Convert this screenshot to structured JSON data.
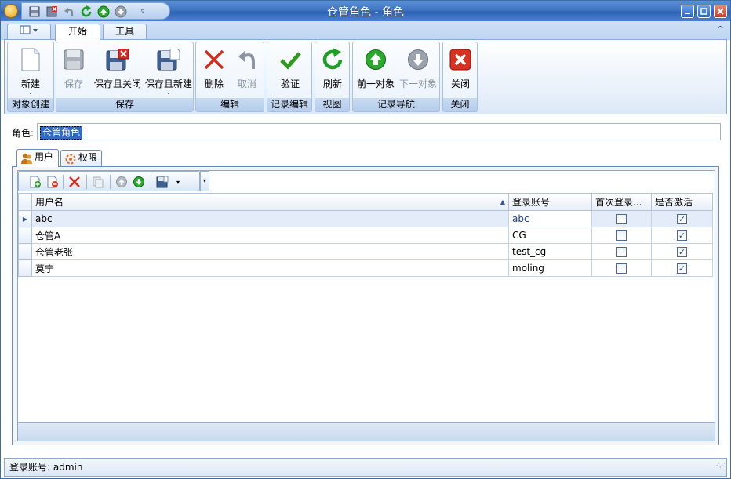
{
  "window": {
    "title": "仓管角色 - 角色"
  },
  "quick_access": [
    "save-icon",
    "save-close-icon",
    "undo-icon",
    "refresh-icon",
    "prev-icon",
    "next-icon",
    "customize-icon"
  ],
  "ribbon_tabs": [
    {
      "label": "开始",
      "active": true
    },
    {
      "label": "工具",
      "active": false
    }
  ],
  "ribbon": {
    "groups": [
      {
        "caption": "对象创建",
        "buttons": [
          {
            "label": "新建",
            "icon": "new-document-icon",
            "enabled": true,
            "dropdown": true
          }
        ]
      },
      {
        "caption": "保存",
        "buttons": [
          {
            "label": "保存",
            "icon": "save-icon",
            "enabled": false
          },
          {
            "label": "保存且关闭",
            "icon": "save-close-icon",
            "enabled": true
          },
          {
            "label": "保存且新建",
            "icon": "save-new-icon",
            "enabled": true,
            "dropdown": true
          }
        ]
      },
      {
        "caption": "编辑",
        "buttons": [
          {
            "label": "删除",
            "icon": "delete-icon",
            "enabled": true
          },
          {
            "label": "取消",
            "icon": "undo-icon",
            "enabled": false
          }
        ]
      },
      {
        "caption": "记录编辑",
        "buttons": [
          {
            "label": "验证",
            "icon": "check-icon",
            "enabled": true
          }
        ]
      },
      {
        "caption": "视图",
        "buttons": [
          {
            "label": "刷新",
            "icon": "refresh-icon",
            "enabled": true
          }
        ]
      },
      {
        "caption": "记录导航",
        "buttons": [
          {
            "label": "前一对象",
            "icon": "prev-object-icon",
            "enabled": true
          },
          {
            "label": "下一对象",
            "icon": "next-object-icon",
            "enabled": false
          }
        ]
      },
      {
        "caption": "关闭",
        "buttons": [
          {
            "label": "关闭",
            "icon": "close-icon",
            "enabled": true
          }
        ]
      }
    ]
  },
  "role": {
    "label": "角色:",
    "value": "仓管角色"
  },
  "sub_tabs": [
    {
      "label": "用户",
      "icon": "users-icon",
      "active": true
    },
    {
      "label": "权限",
      "icon": "permissions-icon",
      "active": false
    }
  ],
  "grid": {
    "columns": [
      "用户名",
      "登录账号",
      "首次登录...",
      "是否激活"
    ],
    "sorted_column": "用户名",
    "rows": [
      {
        "username": "abc",
        "login": "abc",
        "first_login": false,
        "active": true
      },
      {
        "username": "仓管A",
        "login": "CG",
        "first_login": false,
        "active": true
      },
      {
        "username": "仓管老张",
        "login": "test_cg",
        "first_login": false,
        "active": true
      },
      {
        "username": "莫宁",
        "login": "moling",
        "first_login": false,
        "active": true
      }
    ]
  },
  "status_bar": {
    "text": "登录账号: admin"
  },
  "colors": {
    "title_bar": "#3f74c4",
    "selection": "#3169c6",
    "selected_cell": "#8eabe0"
  }
}
